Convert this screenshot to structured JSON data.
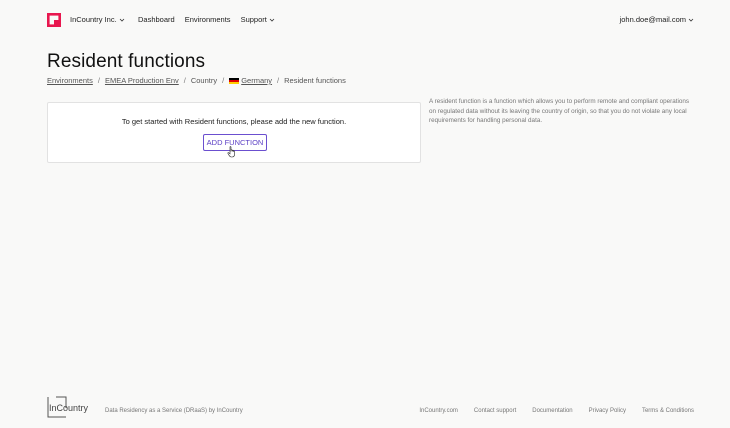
{
  "header": {
    "org_name": "InCountry Inc.",
    "nav": [
      {
        "label": "Dashboard"
      },
      {
        "label": "Environments"
      },
      {
        "label": "Support"
      }
    ],
    "user_email": "john.doe@mail.com"
  },
  "page": {
    "title": "Resident functions"
  },
  "breadcrumb": {
    "items": [
      "Environments",
      "EMEA Production Env",
      "Country",
      "Germany",
      "Resident functions"
    ],
    "separator": "/"
  },
  "card": {
    "message": "To get started with Resident functions, please add the new function.",
    "button_label": "ADD FUNCTION"
  },
  "description": "A resident function is a function which allows you to perform remote and compliant operations on regulated data without its leaving the country of origin, so that you do not violate any local requirements for handling personal data.",
  "footer": {
    "logo_text": "InCountry",
    "tagline": "Data Residency as a Service (DRaaS) by InCountry",
    "links": [
      "InCountry.com",
      "Contact support",
      "Documentation",
      "Privacy Policy",
      "Terms & Conditions"
    ]
  },
  "colors": {
    "brand": "#e8174f",
    "accent": "#6b4fcf",
    "background": "#f9f9f8"
  },
  "icons": {
    "logo": "incountry-logo-icon",
    "dropdown": "chevron-down-icon",
    "flag": "germany-flag-icon",
    "cursor": "hand-pointer-icon"
  }
}
